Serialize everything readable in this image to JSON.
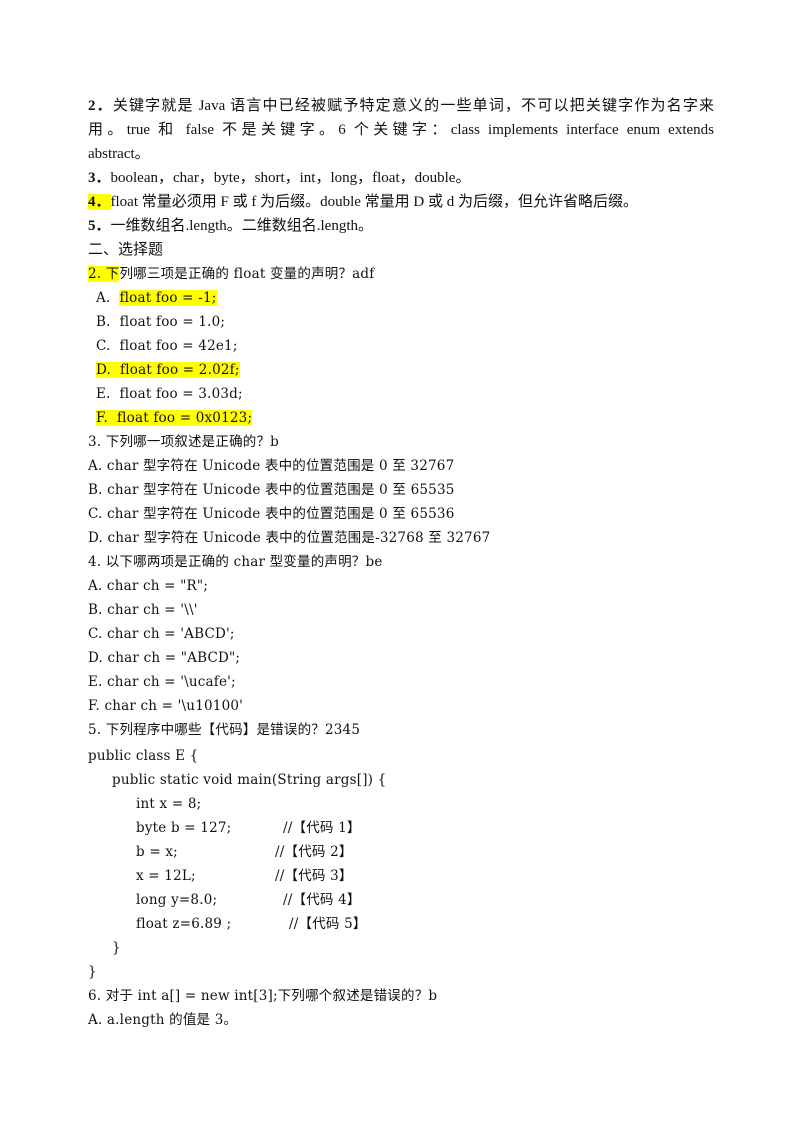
{
  "highlight_color": "#ffff00",
  "section1": {
    "item2": {
      "num": "2．",
      "line1": "关键字就是 Java 语言中已经被赋予特定意义的一些单词，不可以把关键字作为名字来",
      "line2": "用。true 和 false 不是关键字。6 个关键字：class   implements   interface   enum   extends",
      "line3": "abstract。"
    },
    "item3": {
      "num": "3．",
      "text": "boolean，char，byte，short，int，long，float，double。"
    },
    "item4": {
      "num": "4．",
      "text": "float 常量必须用 F 或 f 为后缀。double 常量用 D 或 d 为后缀，但允许省略后缀。"
    },
    "item5": {
      "num": "5．",
      "text": "一维数组名.length。二维数组名.length。"
    }
  },
  "section2": {
    "heading": "二、选择题",
    "q2": {
      "num_hl": "2. 下",
      "question_rest": "列哪三项是正确的 float 变量的声明？adf",
      "options": [
        {
          "label": "A.",
          "code": "float foo = -1;",
          "highlight": "code"
        },
        {
          "label": "B.",
          "code": "float foo = 1.0;",
          "highlight": "none"
        },
        {
          "label": "C.",
          "code": "float foo = 42e1;",
          "highlight": "none"
        },
        {
          "label": "D.",
          "code": "float foo = 2.02f;",
          "highlight": "all"
        },
        {
          "label": "E.",
          "code": "float foo = 3.03d;",
          "highlight": "none"
        },
        {
          "label": "F.",
          "code": "float foo = 0x0123;",
          "highlight": "all"
        }
      ]
    },
    "q3": {
      "question": "3. 下列哪一项叙述是正确的？b",
      "options": [
        "A. char 型字符在 Unicode 表中的位置范围是 0 至 32767",
        "B. char 型字符在 Unicode 表中的位置范围是 0 至 65535",
        "C. char 型字符在 Unicode 表中的位置范围是 0 至 65536",
        "D. char 型字符在 Unicode 表中的位置范围是-32768 至 32767"
      ]
    },
    "q4": {
      "question": "4. 以下哪两项是正确的 char 型变量的声明？be",
      "options": [
        "A. char ch = \"R\";",
        "B. char ch = '\\\\'",
        "C. char ch = 'ABCD';",
        "D. char ch = \"ABCD\";",
        "E. char ch = '\\ucafe';",
        "F. char ch = '\\u10100'"
      ]
    },
    "q5": {
      "question": "5. 下列程序中哪些【代码】是错误的？2345",
      "code": {
        "class_line": "public class E {",
        "main_line": "public static void main(String args[]) {",
        "statements": [
          {
            "code": "int x = 8;",
            "comment": ""
          },
          {
            "code": "byte b = 127;",
            "comment": "//【代码 1】"
          },
          {
            "code": "b = x;",
            "comment": "//【代码 2】"
          },
          {
            "code": "x = 12L;",
            "comment": "//【代码 3】"
          },
          {
            "code": "long y=8.0;",
            "comment": "//【代码 4】"
          },
          {
            "code": "float z=6.89 ;",
            "comment": "//【代码 5】"
          }
        ],
        "inner_close": "}",
        "outer_close": "}"
      }
    },
    "q6": {
      "question": "6. 对于 int a[] = new int[3];下列哪个叙述是错误的？b",
      "options": [
        "A. a.length 的值是 3。"
      ]
    }
  }
}
